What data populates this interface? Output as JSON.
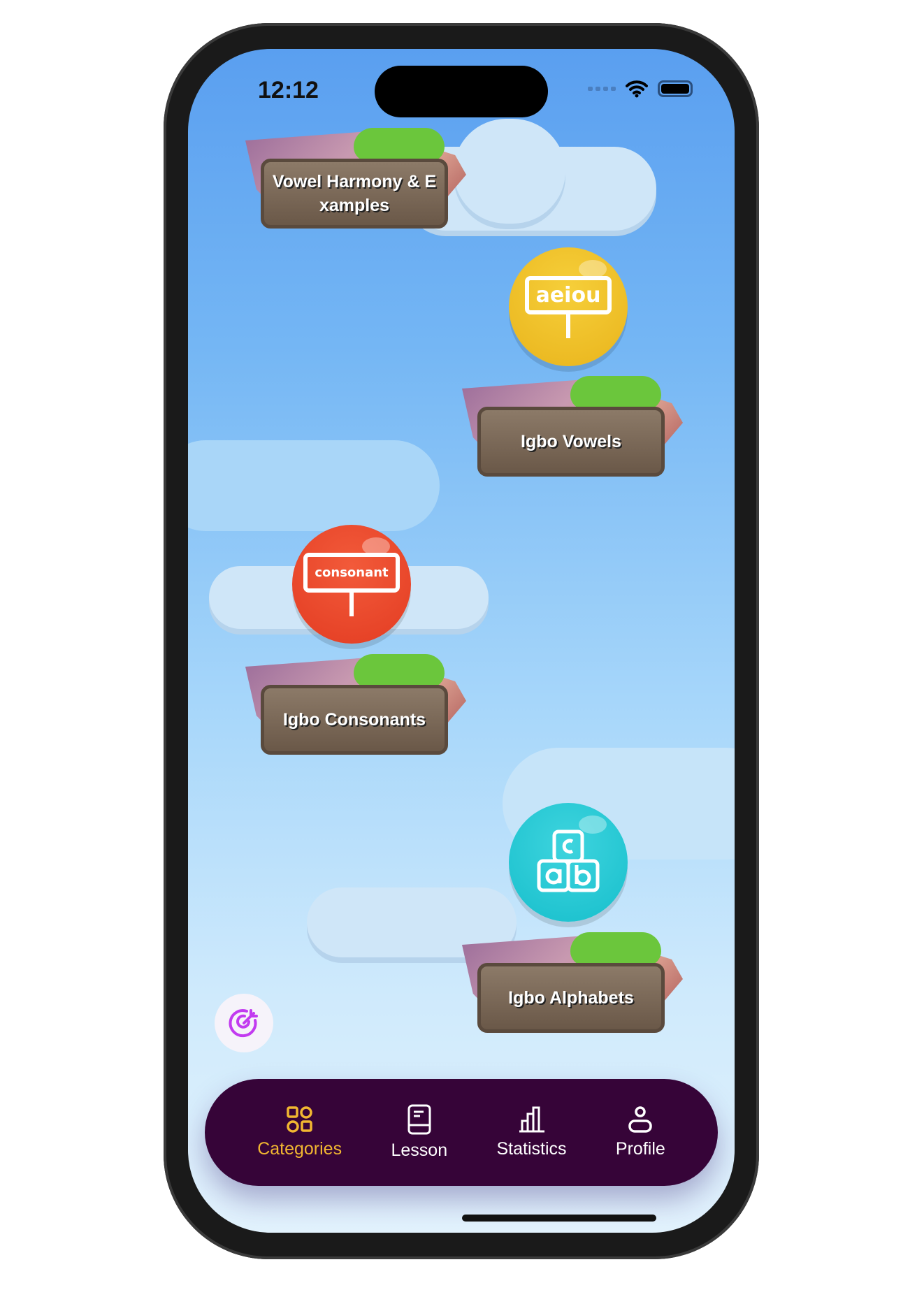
{
  "status_bar": {
    "time": "12:12"
  },
  "lessons": [
    {
      "label": "Vowel Harmony & E xamples"
    },
    {
      "label": "Igbo Vowels",
      "icon": "aeiou-sign-icon",
      "icon_text": "aeiou",
      "color": "#eebd26"
    },
    {
      "label": "Igbo Consonants",
      "icon": "consonant-sign-icon",
      "icon_text": "consonant",
      "color": "#ea4226"
    },
    {
      "label": "Igbo Alphabets",
      "icon": "abc-blocks-icon",
      "color": "#1ec6d2"
    }
  ],
  "floating_button": {
    "icon": "target-icon",
    "color": "#c23bf0"
  },
  "nav": {
    "items": [
      {
        "label": "Categories",
        "icon": "grid-icon",
        "active": true
      },
      {
        "label": "Lesson",
        "icon": "book-icon"
      },
      {
        "label": "Statistics",
        "icon": "bar-chart-icon"
      },
      {
        "label": "Profile",
        "icon": "user-icon"
      }
    ],
    "background": "#360438",
    "active_color": "#f2b731"
  }
}
